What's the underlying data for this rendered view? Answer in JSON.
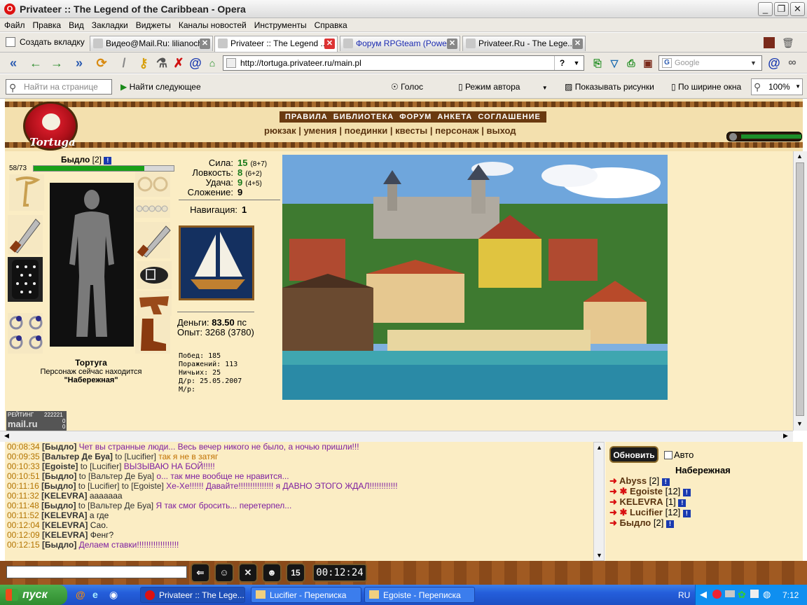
{
  "window": {
    "title": "Privateer :: The Legend of the Caribbean - Opera"
  },
  "menu": [
    "Файл",
    "Правка",
    "Вид",
    "Закладки",
    "Виджеты",
    "Каналы новостей",
    "Инструменты",
    "Справка"
  ],
  "tabs": {
    "new_tab": "Создать вкладку",
    "items": [
      {
        "label": "Видео@Mail.Ru: lilianoch..."
      },
      {
        "label": "Privateer :: The Legend ..."
      },
      {
        "label": "Форум RPGteam (Power..."
      },
      {
        "label": "Privateer.Ru - The Lege..."
      }
    ]
  },
  "nav": {
    "url": "http://tortuga.privateer.ru/main.pl",
    "search_placeholder": "Google"
  },
  "findbar": {
    "placeholder": "Найти на странице",
    "find_next": "Найти следующее",
    "voice": "Голос",
    "author_mode": "Режим автора",
    "show_images": "Показывать рисунки",
    "fit_width": "По ширине окна",
    "zoom": "100%"
  },
  "game": {
    "logo_text": "Tortuga",
    "top_links": [
      "ПРАВИЛА",
      "БИБЛИОТЕКА",
      "ФОРУМ",
      "АНКЕТА",
      "СОГЛАШЕНИЕ"
    ],
    "sub_links": [
      "рюкзак",
      "умения",
      "поединки",
      "квесты",
      "персонаж",
      "выход"
    ],
    "character": {
      "name": "Быдло",
      "level": "[2]",
      "hp_text": "58/73",
      "hp_fraction": 0.79,
      "location_city": "Тортуга",
      "location_line": "Персонаж сейчас находится",
      "location_place": "\"Набережная\""
    },
    "stats": [
      {
        "label": "Сила:",
        "value": "15",
        "bonus": "(8+7)"
      },
      {
        "label": "Ловкость:",
        "value": "8",
        "bonus": "(6+2)"
      },
      {
        "label": "Удача:",
        "value": "9",
        "bonus": "(4+5)"
      },
      {
        "label": "Сложение:",
        "value": "9",
        "bonus": ""
      }
    ],
    "navigation": {
      "label": "Навигация:",
      "value": "1"
    },
    "money": {
      "label": "Деньги:",
      "value": "83.50",
      "unit": "пс"
    },
    "experience": {
      "label": "Опыт:",
      "value": "3268 (3780)"
    },
    "record": {
      "wins": "Побед: 185",
      "losses": "Поражений: 113",
      "draws": "Ничьих: 25",
      "birth": "Д/р: 25.05.2007",
      "place": "М/р:"
    },
    "rating": {
      "label": "РЕЙТИНГ",
      "value": "222221",
      "brand": "mail.ru",
      "n1": "0",
      "n2": "0"
    }
  },
  "chat": [
    {
      "time": "00:08:34",
      "from": "[Быдло]",
      "to": "",
      "msg": "Чет вы странные люди... Весь вечер никого не было, а ночью пришли!!!",
      "color": "#7d1fa0"
    },
    {
      "time": "00:09:35",
      "from": "[Вальтер Де Буа]",
      "to": "[Lucifier]",
      "msg": "так я не в затяг",
      "color": "#c07000"
    },
    {
      "time": "00:10:33",
      "from": "[Egoiste]",
      "to": "[Lucifier]",
      "msg": "ВЫЗЫВАЮ НА БОЙ!!!!!",
      "color": "#7d1fa0"
    },
    {
      "time": "00:10:51",
      "from": "[Быдло]",
      "to": "[Вальтер Де Буа]",
      "msg": "о... так мне вообще не нравится...",
      "color": "#7d1fa0"
    },
    {
      "time": "00:11:16",
      "from": "[Быдло]",
      "to": "[Lucifier] to [Egoiste]",
      "msg": "Хе-Хе!!!!!! Давайте!!!!!!!!!!!!!!! я ДАВНО ЭТОГО ЖДАЛ!!!!!!!!!!!!",
      "color": "#7d1fa0"
    },
    {
      "time": "00:11:32",
      "from": "[KELEVRA]",
      "to": "",
      "msg": "ааааааа",
      "color": "#222"
    },
    {
      "time": "00:11:48",
      "from": "[Быдло]",
      "to": "[Вальтер Де Буа]",
      "msg": "Я так смог бросить... перетерпел...",
      "color": "#7d1fa0"
    },
    {
      "time": "00:11:52",
      "from": "[KELEVRA]",
      "to": "",
      "msg": "а где",
      "color": "#222"
    },
    {
      "time": "00:12:04",
      "from": "[KELEVRA]",
      "to": "",
      "msg": "Сао.",
      "color": "#222"
    },
    {
      "time": "00:12:09",
      "from": "[KELEVRA]",
      "to": "",
      "msg": "Фенг?",
      "color": "#222"
    },
    {
      "time": "00:12:15",
      "from": "[Быдло]",
      "to": "",
      "msg": "Делаем ставки!!!!!!!!!!!!!!!!!!",
      "color": "#7d1fa0"
    }
  ],
  "side": {
    "refresh": "Обновить",
    "auto": "Авто",
    "location": "Набережная",
    "players": [
      {
        "name": "Abyss",
        "level": "[2]",
        "clan": false
      },
      {
        "name": "Egoiste",
        "level": "[12]",
        "clan": true
      },
      {
        "name": "KELEVRA",
        "level": "[1]",
        "clan": false
      },
      {
        "name": "Lucifier",
        "level": "[12]",
        "clan": true
      },
      {
        "name": "Быдло",
        "level": "[2]",
        "clan": false
      }
    ]
  },
  "gamebar": {
    "timer": "00:12:24",
    "count": "15"
  },
  "taskbar": {
    "start": "пуск",
    "tasks": [
      "Privateer :: The Lege...",
      "Lucifier - Переписка",
      "Egoiste - Переписка"
    ],
    "lang": "RU",
    "clock": "7:12"
  }
}
